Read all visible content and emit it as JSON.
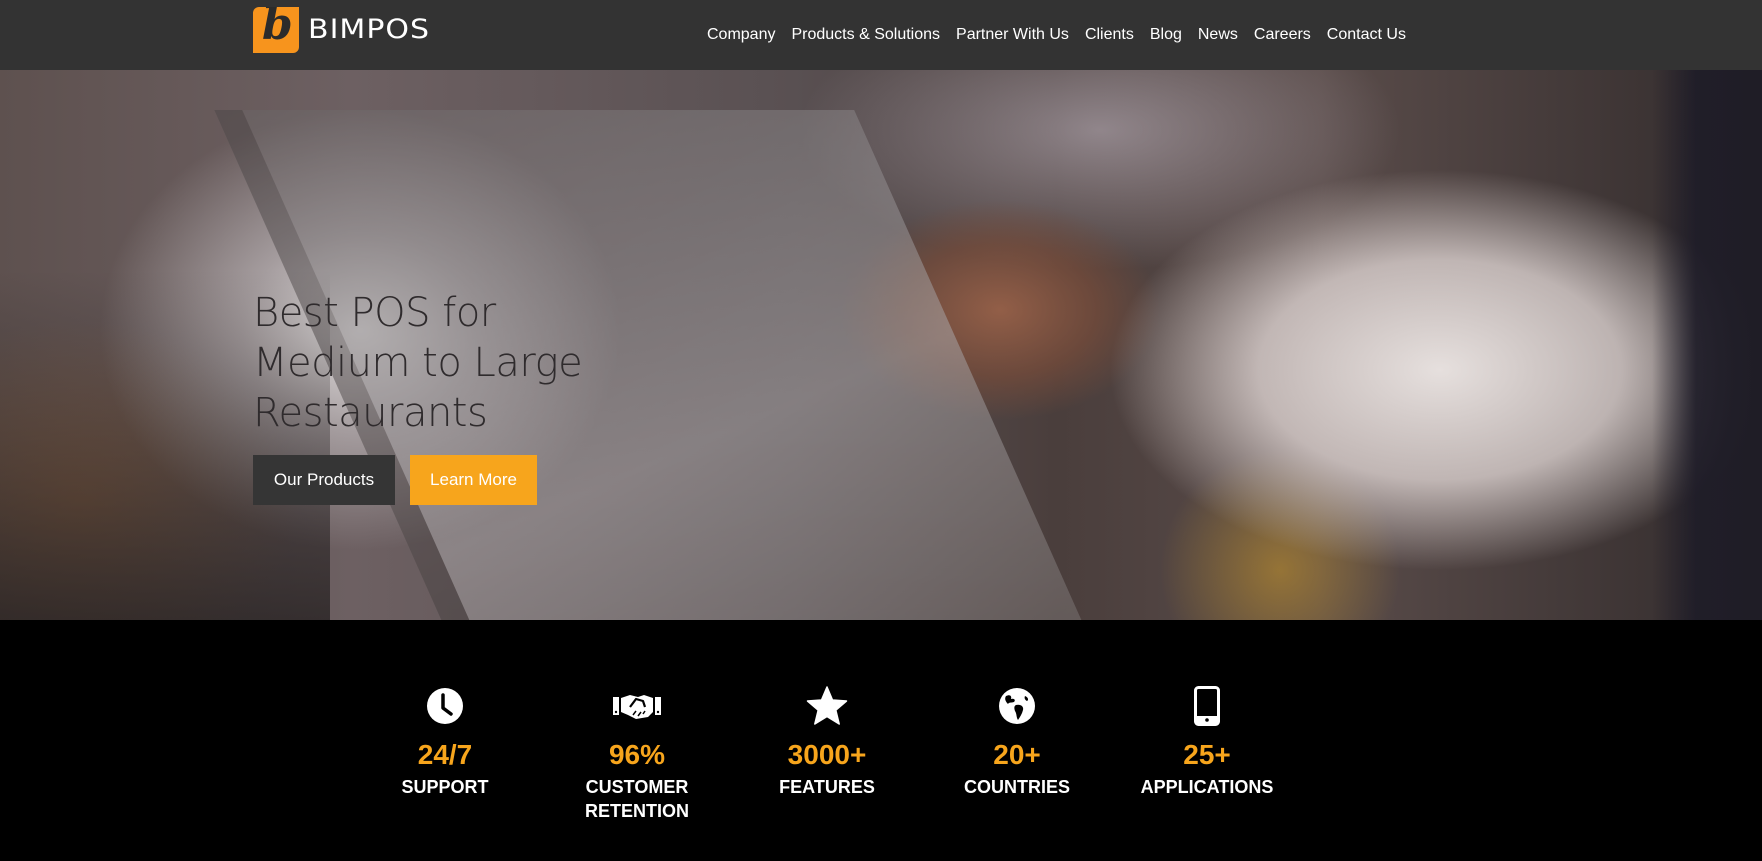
{
  "brand": {
    "name": "BIMPOS",
    "logo_letter": "b",
    "accent_color": "#f7a51c",
    "nav_bg": "#333333"
  },
  "nav": {
    "items": [
      {
        "label": "Company"
      },
      {
        "label": "Products & Solutions"
      },
      {
        "label": "Partner With Us"
      },
      {
        "label": "Clients"
      },
      {
        "label": "Blog"
      },
      {
        "label": "News"
      },
      {
        "label": "Careers"
      },
      {
        "label": "Contact Us"
      }
    ]
  },
  "hero": {
    "title_lines": [
      "Best POS for",
      "Medium to Large",
      "Restaurants"
    ],
    "primary_button": "Our Products",
    "secondary_button": "Learn More"
  },
  "stats": [
    {
      "icon": "clock-icon",
      "value": "24/7",
      "label_lines": [
        "SUPPORT"
      ]
    },
    {
      "icon": "handshake-icon",
      "value": "96%",
      "label_lines": [
        "CUSTOMER",
        "RETENTION"
      ]
    },
    {
      "icon": "star-icon",
      "value": "3000+",
      "label_lines": [
        "FEATURES"
      ]
    },
    {
      "icon": "globe-icon",
      "value": "20+",
      "label_lines": [
        "COUNTRIES"
      ]
    },
    {
      "icon": "mobile-phone-icon",
      "value": "25+",
      "label_lines": [
        "APPLICATIONS"
      ]
    }
  ]
}
